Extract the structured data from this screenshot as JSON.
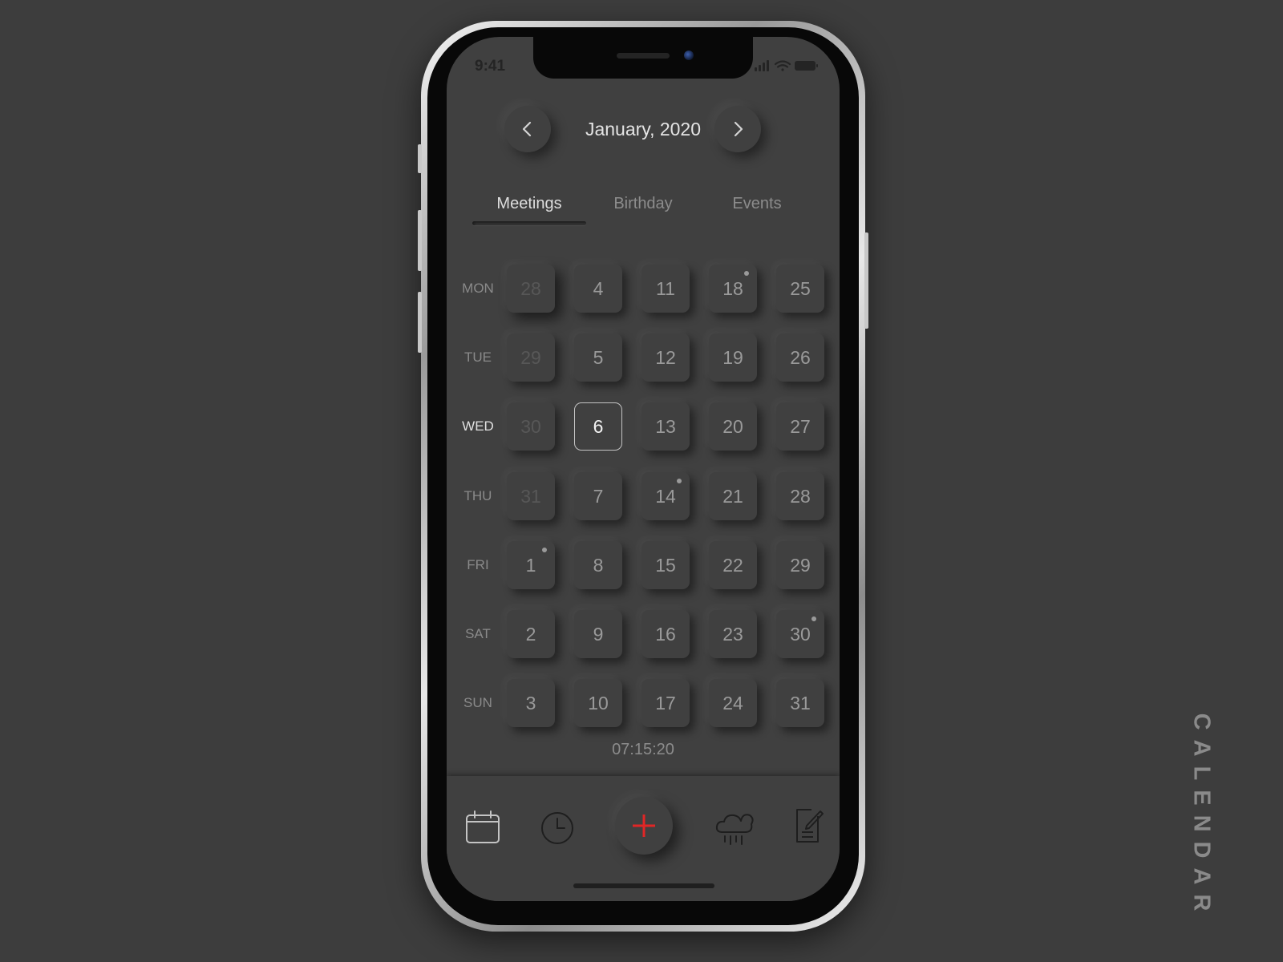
{
  "status_bar": {
    "time": "9:41"
  },
  "header": {
    "month_label": "January, 2020"
  },
  "tabs": [
    {
      "label": "Meetings",
      "active": true
    },
    {
      "label": "Birthday",
      "active": false
    },
    {
      "label": "Events",
      "active": false
    }
  ],
  "calendar": {
    "weekdays": [
      "MON",
      "TUE",
      "WED",
      "THU",
      "FRI",
      "SAT",
      "SUN"
    ],
    "current_weekday": "WED",
    "columns": [
      [
        {
          "day": "28",
          "muted": true,
          "dot": false
        },
        {
          "day": "29",
          "muted": true,
          "dot": false
        },
        {
          "day": "30",
          "muted": true,
          "dot": false
        },
        {
          "day": "31",
          "muted": true,
          "dot": false
        },
        {
          "day": "1",
          "muted": false,
          "dot": true
        },
        {
          "day": "2",
          "muted": false,
          "dot": false
        },
        {
          "day": "3",
          "muted": false,
          "dot": false
        }
      ],
      [
        {
          "day": "4",
          "muted": false,
          "dot": false
        },
        {
          "day": "5",
          "muted": false,
          "dot": false
        },
        {
          "day": "6",
          "muted": false,
          "dot": false,
          "selected": true
        },
        {
          "day": "7",
          "muted": false,
          "dot": false
        },
        {
          "day": "8",
          "muted": false,
          "dot": false
        },
        {
          "day": "9",
          "muted": false,
          "dot": false
        },
        {
          "day": "10",
          "muted": false,
          "dot": false
        }
      ],
      [
        {
          "day": "11",
          "muted": false,
          "dot": false
        },
        {
          "day": "12",
          "muted": false,
          "dot": false
        },
        {
          "day": "13",
          "muted": false,
          "dot": false
        },
        {
          "day": "14",
          "muted": false,
          "dot": true
        },
        {
          "day": "15",
          "muted": false,
          "dot": false
        },
        {
          "day": "16",
          "muted": false,
          "dot": false
        },
        {
          "day": "17",
          "muted": false,
          "dot": false
        }
      ],
      [
        {
          "day": "18",
          "muted": false,
          "dot": true
        },
        {
          "day": "19",
          "muted": false,
          "dot": false
        },
        {
          "day": "20",
          "muted": false,
          "dot": false
        },
        {
          "day": "21",
          "muted": false,
          "dot": false
        },
        {
          "day": "22",
          "muted": false,
          "dot": false
        },
        {
          "day": "23",
          "muted": false,
          "dot": false
        },
        {
          "day": "24",
          "muted": false,
          "dot": false
        }
      ],
      [
        {
          "day": "25",
          "muted": false,
          "dot": false
        },
        {
          "day": "26",
          "muted": false,
          "dot": false
        },
        {
          "day": "27",
          "muted": false,
          "dot": false
        },
        {
          "day": "28",
          "muted": false,
          "dot": false
        },
        {
          "day": "29",
          "muted": false,
          "dot": false
        },
        {
          "day": "30",
          "muted": false,
          "dot": true
        },
        {
          "day": "31",
          "muted": false,
          "dot": false
        }
      ]
    ]
  },
  "clock": "07:15:20",
  "tab_bar": {
    "icons": [
      "calendar-icon",
      "clock-icon",
      "add-icon",
      "rain-cloud-icon",
      "notes-icon"
    ],
    "add_color": "#e02626"
  },
  "side_label": "CALENDAR",
  "colors": {
    "background": "#3d3d3d",
    "screen": "#404040",
    "accent": "#e02626"
  }
}
